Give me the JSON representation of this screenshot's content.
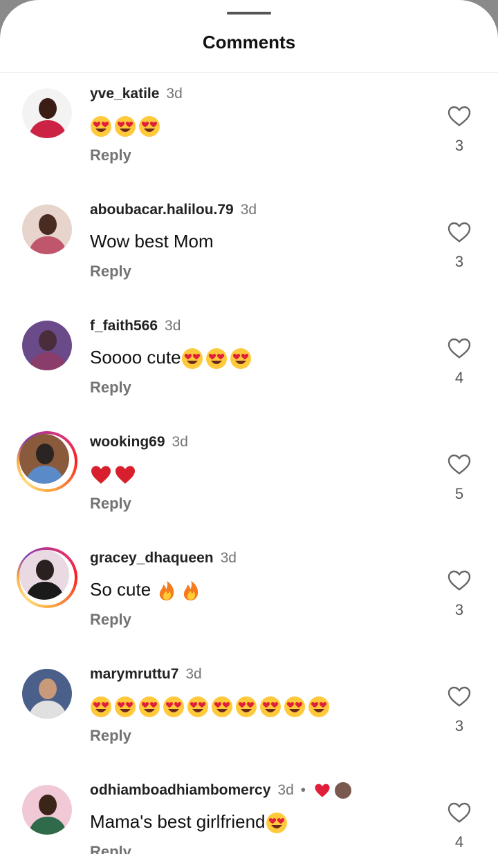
{
  "header": {
    "title": "Comments"
  },
  "comments": [
    {
      "username": "yve_katile",
      "time": "3d",
      "text": "",
      "emojis": [
        "smiling-face-with-heart-eyes",
        "smiling-face-with-heart-eyes",
        "smiling-face-with-heart-eyes"
      ],
      "reply_label": "Reply",
      "like_count": "3",
      "story_ring": false,
      "avatar_colors": [
        "#f3f3f3",
        "#3b1d16",
        "#cc2244"
      ]
    },
    {
      "username": "aboubacar.halilou.79",
      "time": "3d",
      "text": "Wow best Mom",
      "emojis": [],
      "reply_label": "Reply",
      "like_count": "3",
      "story_ring": false,
      "avatar_colors": [
        "#e7d4cc",
        "#4a2b22",
        "#c0566b"
      ]
    },
    {
      "username": "f_faith566",
      "time": "3d",
      "text": "Soooo cute",
      "emojis": [
        "smiling-face-with-heart-eyes",
        "smiling-face-with-heart-eyes",
        "smiling-face-with-heart-eyes"
      ],
      "reply_label": "Reply",
      "like_count": "4",
      "story_ring": false,
      "avatar_colors": [
        "#6b4a8a",
        "#4a2d3a",
        "#8a3c6a"
      ]
    },
    {
      "username": "wooking69",
      "time": "3d",
      "text": "",
      "emojis": [
        "red-heart",
        "red-heart"
      ],
      "reply_label": "Reply",
      "like_count": "5",
      "story_ring": true,
      "avatar_colors": [
        "#8a5a3c",
        "#2a2422",
        "#5a8ac8"
      ]
    },
    {
      "username": "gracey_dhaqueen",
      "time": "3d",
      "text": "So cute ",
      "emojis": [
        "fire",
        "fire"
      ],
      "reply_label": "Reply",
      "like_count": "3",
      "story_ring": true,
      "avatar_colors": [
        "#e8d9e3",
        "#2b2020",
        "#1a1a1a"
      ]
    },
    {
      "username": "marymruttu7",
      "time": "3d",
      "text": "",
      "emojis": [
        "smiling-face-with-heart-eyes",
        "smiling-face-with-heart-eyes",
        "smiling-face-with-heart-eyes",
        "smiling-face-with-heart-eyes",
        "smiling-face-with-heart-eyes",
        "smiling-face-with-heart-eyes",
        "smiling-face-with-heart-eyes",
        "smiling-face-with-heart-eyes",
        "smiling-face-with-heart-eyes",
        "smiling-face-with-heart-eyes"
      ],
      "reply_label": "Reply",
      "like_count": "3",
      "story_ring": false,
      "avatar_colors": [
        "#4a5f8a",
        "#c89a7a",
        "#e0e0e0"
      ]
    },
    {
      "username": "odhiamboadhiambomercy",
      "time": "3d",
      "text": "Mama's best girlfriend",
      "emojis": [
        "smiling-face-with-heart-eyes"
      ],
      "reply_label": "Reply",
      "like_count": "4",
      "story_ring": false,
      "avatar_colors": [
        "#f1c9d6",
        "#3b2418",
        "#2f6a4a"
      ],
      "liked_by_author": true
    }
  ],
  "colors": {
    "heart_red": "#e0203a",
    "emoji_yellow": "#ffc93c",
    "muted_text": "#737373"
  }
}
